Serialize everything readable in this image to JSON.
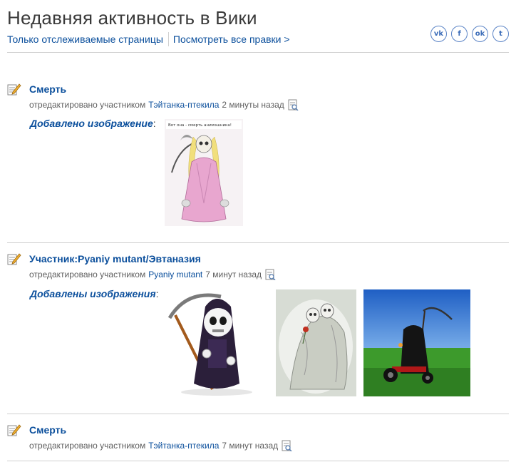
{
  "header": {
    "title": "Недавняя активность в Вики",
    "filter_watched": "Только отслеживаемые страницы",
    "filter_all": "Посмотреть все правки >"
  },
  "social": [
    {
      "name": "vkontakte",
      "glyph": "vk"
    },
    {
      "name": "facebook",
      "glyph": "f"
    },
    {
      "name": "odnoklassniki",
      "glyph": "ok"
    },
    {
      "name": "twitter",
      "glyph": "t"
    }
  ],
  "entries": [
    {
      "title": "Смерть",
      "meta_prefix": "отредактировано участником",
      "user": "Тэйтанка-птекила",
      "time": "2 минуты назад",
      "added_label": "Добавлено изображение",
      "images": [
        "anime-death-girl-image"
      ]
    },
    {
      "title": "Участник:Pyaniy mutant/Эвтаназия",
      "meta_prefix": "отредактировано участником",
      "user": "Pyaniy mutant",
      "time": "7 минут назад",
      "added_label": "Добавлены изображения",
      "images": [
        "chibi-reaper-image",
        "skeleton-lovers-image",
        "reaper-on-tricycle-image"
      ]
    },
    {
      "title": "Смерть",
      "meta_prefix": "отредактировано участником",
      "user": "Тэйтанка-птекила",
      "time": "7 минут назад"
    }
  ],
  "image_caption_1": "Вот она - смерть анимэшника!",
  "colors": {
    "link": "#0b4f9c",
    "text": "#3a3a3a",
    "rule": "#cfcfcf"
  }
}
